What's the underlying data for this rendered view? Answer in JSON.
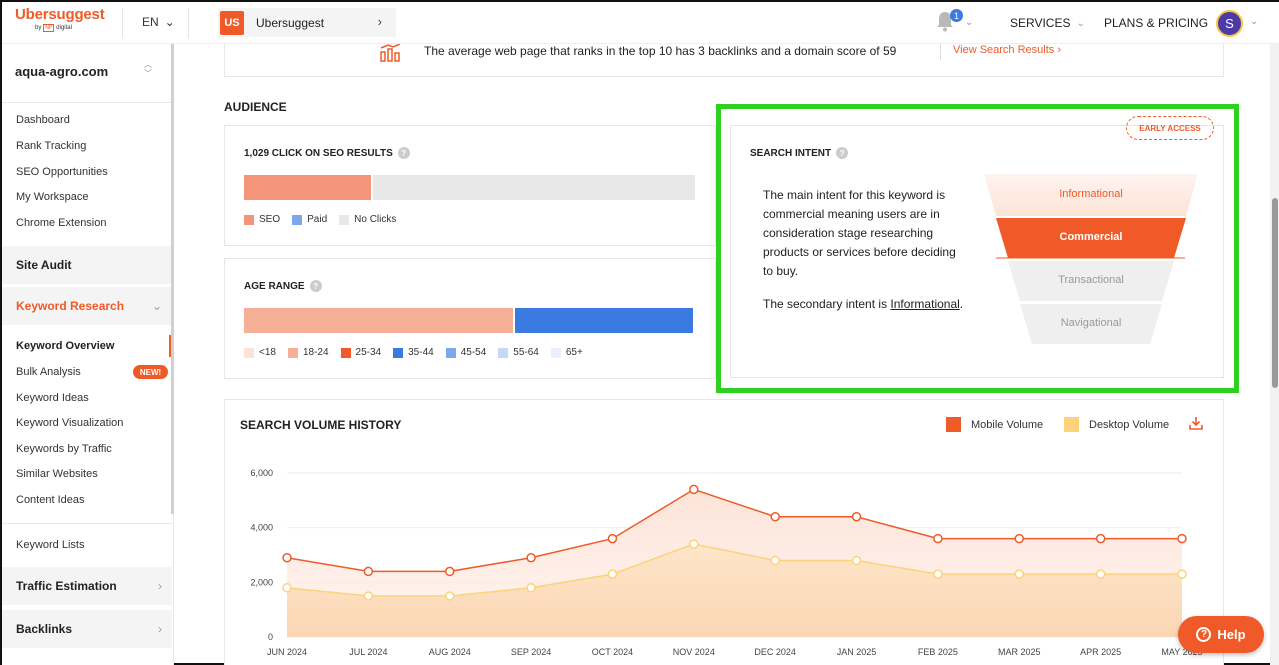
{
  "header": {
    "logo": "Ubersuggest",
    "logo_by": "by",
    "logo_np": "NP",
    "logo_digital": "digital",
    "language": "EN",
    "project_badge": "US",
    "project_name": "Ubersuggest",
    "notification_count": "1",
    "services": "SERVICES",
    "plans": "PLANS & PRICING",
    "avatar_letter": "S"
  },
  "sidebar": {
    "domain": "aqua-agro.com",
    "top_items": [
      "Dashboard",
      "Rank Tracking",
      "SEO Opportunities",
      "My Workspace",
      "Chrome Extension"
    ],
    "site_audit": "Site Audit",
    "keyword_research": "Keyword Research",
    "kr_items": [
      "Keyword Overview",
      "Bulk Analysis",
      "Keyword Ideas",
      "Keyword Visualization",
      "Keywords by Traffic",
      "Similar Websites",
      "Content Ideas"
    ],
    "new_badge": "NEW!",
    "keyword_lists": "Keyword Lists",
    "traffic_estimation": "Traffic Estimation",
    "backlinks": "Backlinks"
  },
  "banner": {
    "text": "The average web page that ranks in the top 10 has 3 backlinks and a domain score of 59",
    "link": "View Search Results"
  },
  "audience": {
    "title": "AUDIENCE",
    "clicks": {
      "title": "1,029 CLICK ON SEO RESULTS",
      "seo_fraction": 0.285,
      "paid_fraction": 0.0,
      "legend": [
        "SEO",
        "Paid",
        "No Clicks"
      ]
    },
    "age": {
      "title": "AGE RANGE",
      "segments": [
        {
          "label": "<18",
          "fraction": 0.0,
          "color": "#fde3d7"
        },
        {
          "label": "18-24",
          "fraction": 0.6,
          "color": "#f6b097"
        },
        {
          "label": "25-34",
          "fraction": 0.0,
          "color": "#f05a28"
        },
        {
          "label": "35-44",
          "fraction": 0.4,
          "color": "#3b7ae0"
        },
        {
          "label": "45-54",
          "fraction": 0.0,
          "color": "#7ba7ec"
        },
        {
          "label": "55-64",
          "fraction": 0.0,
          "color": "#c6d8f6"
        },
        {
          "label": "65+",
          "fraction": 0.0,
          "color": "#e9f0fb"
        }
      ]
    }
  },
  "search_intent": {
    "title": "SEARCH INTENT",
    "early_access": "EARLY ACCESS",
    "description": "The main intent for this keyword is commercial meaning users are in consideration stage researching products or services before deciding to buy.",
    "secondary_prefix": "The secondary intent is",
    "secondary_value": "Informational",
    "secondary_suffix": ".",
    "funnel": [
      "Informational",
      "Commercial",
      "Transactional",
      "Navigational"
    ],
    "active": "Commercial"
  },
  "volume_history": {
    "title": "SEARCH VOLUME HISTORY",
    "legend_mobile": "Mobile Volume",
    "legend_desktop": "Desktop Volume",
    "colors": {
      "mobile": "#f05a28",
      "desktop": "#fcd37a"
    }
  },
  "chart_data": {
    "type": "area",
    "title": "SEARCH VOLUME HISTORY",
    "categories": [
      "JUN 2024",
      "JUL 2024",
      "AUG 2024",
      "SEP 2024",
      "OCT 2024",
      "NOV 2024",
      "DEC 2024",
      "JAN 2025",
      "FEB 2025",
      "MAR 2025",
      "APR 2025",
      "MAY 2025"
    ],
    "series": [
      {
        "name": "Mobile Volume",
        "values": [
          2900,
          2400,
          2400,
          2900,
          3600,
          5400,
          4400,
          4400,
          3600,
          3600,
          3600,
          3600
        ]
      },
      {
        "name": "Desktop Volume",
        "values": [
          1800,
          1500,
          1500,
          1800,
          2300,
          3400,
          2800,
          2800,
          2300,
          2300,
          2300,
          2300
        ]
      }
    ],
    "yticks": [
      "0",
      "2,000",
      "4,000",
      "6,000"
    ],
    "ylim": [
      0,
      6000
    ],
    "grid": true,
    "legend": "top-right"
  },
  "help": {
    "label": "Help"
  }
}
